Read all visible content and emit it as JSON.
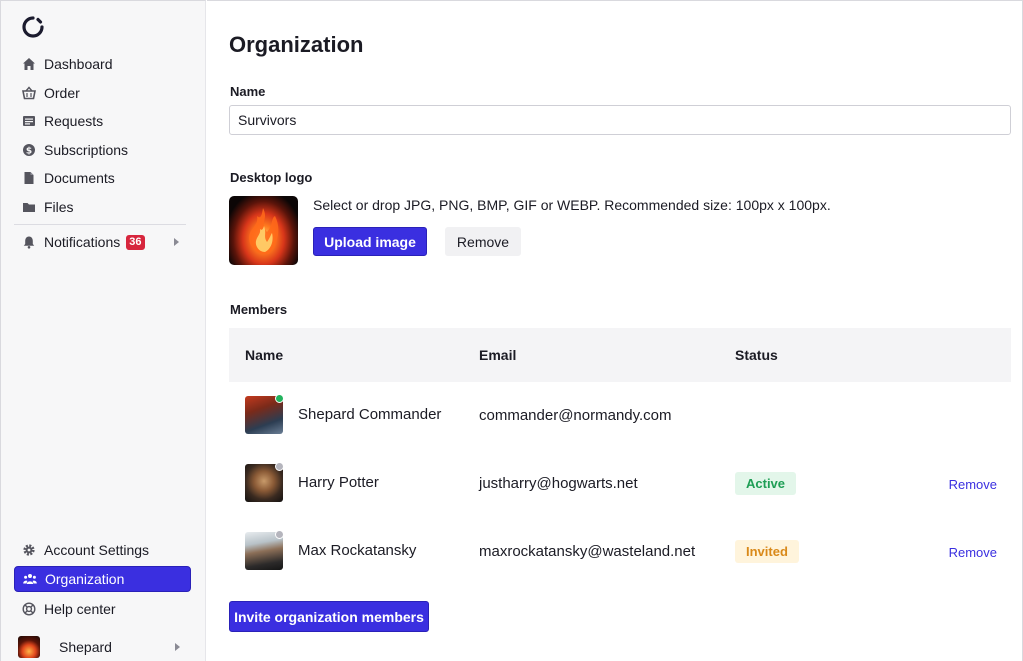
{
  "sidebar": {
    "nav": [
      {
        "label": "Dashboard",
        "icon": "home-icon"
      },
      {
        "label": "Order",
        "icon": "basket-icon"
      },
      {
        "label": "Requests",
        "icon": "list-icon"
      },
      {
        "label": "Subscriptions",
        "icon": "dollar-icon"
      },
      {
        "label": "Documents",
        "icon": "document-icon"
      },
      {
        "label": "Files",
        "icon": "folder-icon"
      }
    ],
    "notifications": {
      "label": "Notifications",
      "count": "36"
    },
    "bottom": [
      {
        "label": "Account Settings",
        "icon": "gear-icon"
      },
      {
        "label": "Organization",
        "icon": "people-icon"
      },
      {
        "label": "Help center",
        "icon": "lifebuoy-icon"
      }
    ],
    "user": {
      "name": "Shepard"
    }
  },
  "page": {
    "title": "Organization",
    "name_label": "Name",
    "name_value": "Survivors",
    "logo_label": "Desktop logo",
    "logo_hint": "Select or drop JPG, PNG, BMP, GIF or WEBP. Recommended size: 100px x 100px.",
    "upload_label": "Upload image",
    "remove_label": "Remove",
    "members_label": "Members",
    "invite_label": "Invite organization members"
  },
  "table": {
    "headers": [
      "Name",
      "Email",
      "Status"
    ],
    "rows": [
      {
        "name": "Shepard Commander",
        "email": "commander@normandy.com",
        "status": "",
        "online": true,
        "action": ""
      },
      {
        "name": "Harry Potter",
        "email": "justharry@hogwarts.net",
        "status": "Active",
        "online": false,
        "action": "Remove"
      },
      {
        "name": "Max Rockatansky",
        "email": "maxrockatansky@wasteland.net",
        "status": "Invited",
        "online": false,
        "action": "Remove"
      }
    ]
  },
  "colors": {
    "accent": "#3a2fe0",
    "badge": "#d7263d",
    "online": "#22b35e",
    "offline": "#b5b5bd",
    "active_bg": "#e3f6ea",
    "active_fg": "#1e9e55",
    "invited_bg": "#fff4dc",
    "invited_fg": "#d9891a"
  }
}
